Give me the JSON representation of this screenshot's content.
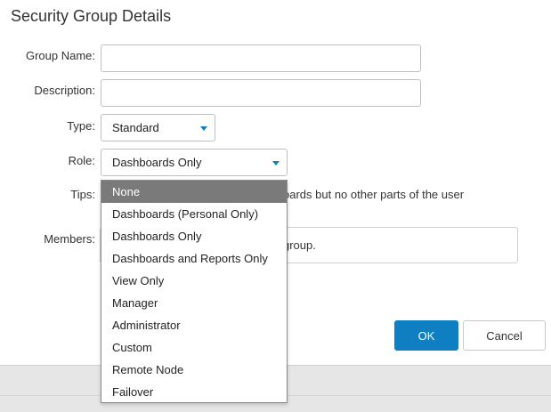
{
  "dialog": {
    "title": "Security Group Details"
  },
  "form": {
    "group_name": {
      "label": "Group Name:",
      "value": ""
    },
    "description": {
      "label": "Description:",
      "value": ""
    },
    "type": {
      "label": "Type:",
      "value": "Standard"
    },
    "role": {
      "label": "Role:",
      "value": "Dashboards Only"
    },
    "tips": {
      "label": "Tips:",
      "text_visible": "oards but no other parts of the user"
    },
    "members": {
      "label": "Members:",
      "text_visible": "group."
    }
  },
  "role_dropdown": {
    "options": [
      "None",
      "Dashboards (Personal Only)",
      "Dashboards Only",
      "Dashboards and Reports Only",
      "View Only",
      "Manager",
      "Administrator",
      "Custom",
      "Remote Node",
      "Failover"
    ],
    "highlighted": "None"
  },
  "buttons": {
    "ok": "OK",
    "cancel": "Cancel"
  },
  "colors": {
    "accent": "#0f7fc1",
    "highlight": "#7a7a7a",
    "footer": "#e6e6e6"
  }
}
